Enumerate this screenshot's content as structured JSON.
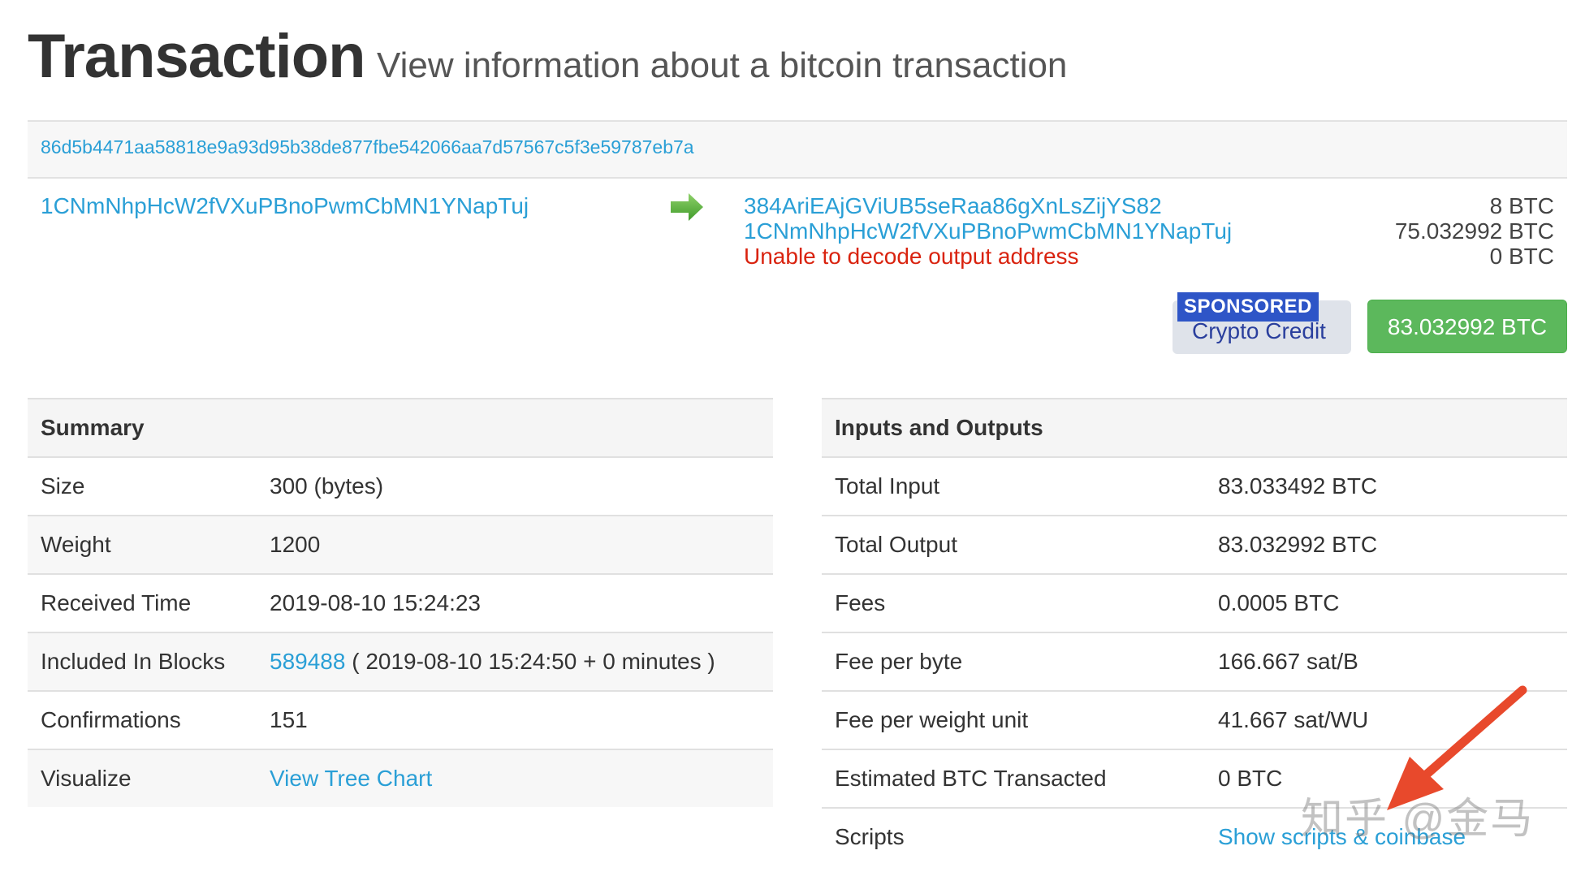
{
  "header": {
    "title": "Transaction",
    "subtitle": "View information about a bitcoin transaction"
  },
  "transaction": {
    "hash": "86d5b4471aa58818e9a93d95b38de877fbe542066aa7d57567c5f3e59787eb7a",
    "input_address": "1CNmNhpHcW2fVXuPBnoPwmCbMN1YNapTuj",
    "outputs": [
      {
        "address": "384AriEAjGViUB5seRaa86gXnLsZijYS82",
        "amount": "8 BTC"
      },
      {
        "address": "1CNmNhpHcW2fVXuPBnoPwmCbMN1YNapTuj",
        "amount": "75.032992 BTC"
      },
      {
        "error": "Unable to decode output address",
        "amount": "0 BTC"
      }
    ],
    "sponsored_label": "SPONSORED",
    "sponsored_text": "Crypto Credit",
    "total_button": "83.032992 BTC"
  },
  "summary": {
    "heading": "Summary",
    "rows": [
      {
        "label": "Size",
        "value": "300 (bytes)"
      },
      {
        "label": "Weight",
        "value": "1200"
      },
      {
        "label": "Received Time",
        "value": "2019-08-10 15:24:23"
      },
      {
        "label": "Included In Blocks",
        "block_link": "589488",
        "value": "( 2019-08-10 15:24:50 + 0 minutes )"
      },
      {
        "label": "Confirmations",
        "value": "151"
      },
      {
        "label": "Visualize",
        "link": "View Tree Chart"
      }
    ]
  },
  "io": {
    "heading": "Inputs and Outputs",
    "rows": [
      {
        "label": "Total Input",
        "value": "83.033492 BTC"
      },
      {
        "label": "Total Output",
        "value": "83.032992 BTC"
      },
      {
        "label": "Fees",
        "value": "0.0005 BTC"
      },
      {
        "label": "Fee per byte",
        "value": "166.667 sat/B"
      },
      {
        "label": "Fee per weight unit",
        "value": "41.667 sat/WU"
      },
      {
        "label": "Estimated BTC Transacted",
        "value": "0 BTC"
      },
      {
        "label": "Scripts",
        "link": "Show scripts & coinbase"
      }
    ]
  },
  "watermark": "知乎 @金马",
  "colors": {
    "link": "#2a9fd6",
    "error": "#d9230f",
    "success": "#5cb85c",
    "annotation_arrow": "#e8492c"
  }
}
